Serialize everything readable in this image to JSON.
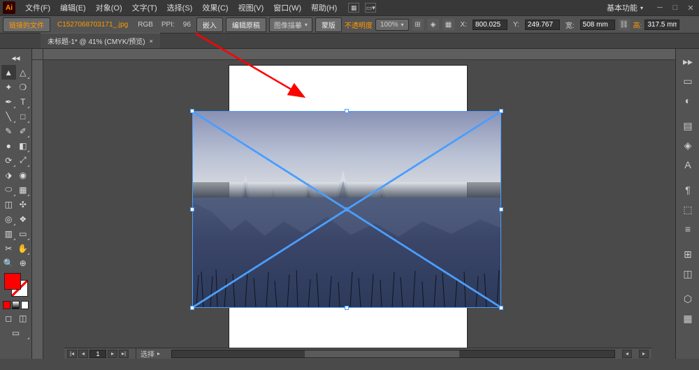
{
  "app": {
    "logo": "Ai"
  },
  "menu": [
    "文件(F)",
    "编辑(E)",
    "对象(O)",
    "文字(T)",
    "选择(S)",
    "效果(C)",
    "视图(V)",
    "窗口(W)",
    "帮助(H)"
  ],
  "workspace": "基本功能",
  "control": {
    "linked_file_btn": "链接的文件",
    "filename": "C1527068703171_.jpg",
    "colormode": "RGB",
    "ppi_label": "PPI:",
    "ppi_value": "96",
    "embed": "嵌入",
    "edit_original": "编辑原稿",
    "image_trace": "图像描摹",
    "mask": "蒙版",
    "opacity_label": "不透明度",
    "zoom": "100%",
    "x_label": "X:",
    "x_value": "800.025",
    "y_label": "Y:",
    "y_value": "249.767",
    "w_label": "宽:",
    "w_value": "508 mm",
    "h_label": "高:",
    "h_value": "317.5 mm"
  },
  "tab": {
    "name": "未标题-1* @ 41% (CMYK/预览)"
  },
  "status": {
    "artboard": "1",
    "artboard_of": "1",
    "label": "选择"
  },
  "tool_icons": {
    "selection": "▲",
    "direct": "△",
    "wand": "✦",
    "lasso": "❍",
    "pen": "✒",
    "type": "T",
    "line": "╲",
    "rect": "□",
    "brush": "✎",
    "pencil": "✐",
    "blob": "●",
    "eraser": "◧",
    "rotate": "⟳",
    "scale": "⤢",
    "width": "⬗",
    "warp": "◉",
    "shape": "⬭",
    "mesh": "▦",
    "gradient": "◫",
    "eyedrop": "✣",
    "blend": "◎",
    "symbol": "❖",
    "graph": "▥",
    "artboard": "▭",
    "slice": "✂",
    "hand": "✋",
    "zoom": "🔍"
  },
  "right_icons": [
    "▭",
    "◐",
    "▤",
    "◈",
    "A",
    "¶",
    "⬚",
    "≡",
    "⊞",
    "◫",
    "⬡",
    "▦"
  ]
}
